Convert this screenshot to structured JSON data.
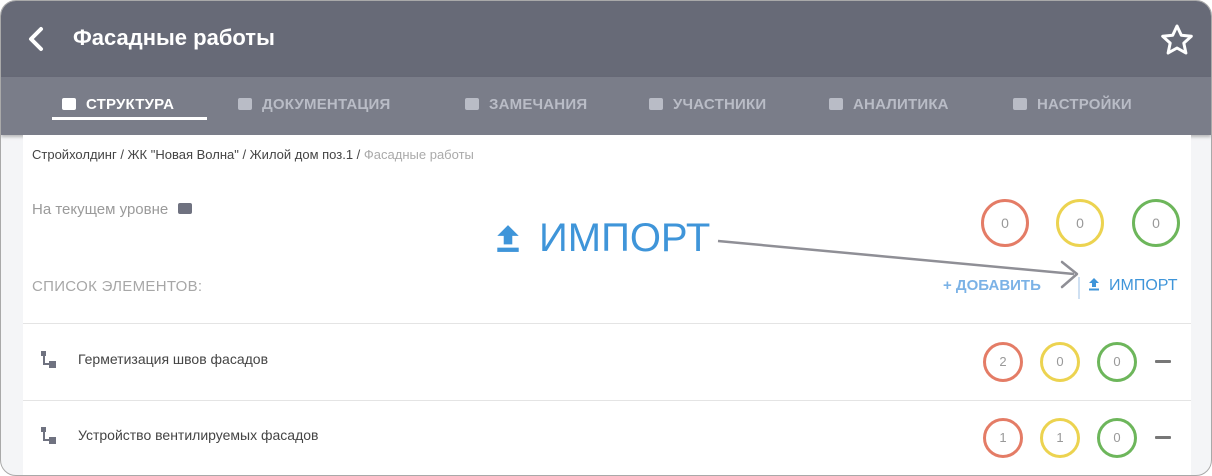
{
  "header": {
    "title": "Фасадные работы"
  },
  "tabs": [
    {
      "label": "СТРУКТУРА"
    },
    {
      "label": "ДОКУМЕНТАЦИЯ"
    },
    {
      "label": "ЗАМЕЧАНИЯ"
    },
    {
      "label": "УЧАСТНИКИ"
    },
    {
      "label": "АНАЛИТИКА"
    },
    {
      "label": "НАСТРОЙКИ"
    }
  ],
  "breadcrumb": {
    "path": "Стройхолдинг / ЖК \"Новая Волна\" / Жилой дом поз.1 /",
    "current": "Фасадные работы"
  },
  "level": {
    "label": "На текущем уровне",
    "counts": {
      "red": "0",
      "yellow": "0",
      "green": "0"
    }
  },
  "list": {
    "label": "СПИСОК ЭЛЕМЕНТОВ:",
    "add_label": "+ ДОБАВИТЬ",
    "import_label": "ИМПОРТ",
    "items": [
      {
        "name": "Герметизация швов фасадов",
        "red": "2",
        "yellow": "0",
        "green": "0"
      },
      {
        "name": "Устройство вентилируемых фасадов",
        "red": "1",
        "yellow": "1",
        "green": "0"
      }
    ]
  },
  "callout": {
    "label": "ИМПОРТ"
  },
  "colors": {
    "header": "#676a77",
    "tabs": "#7a7d89",
    "accent": "#3f95d9",
    "red": "#e47c66",
    "yellow": "#ecd350",
    "green": "#6db65b"
  }
}
